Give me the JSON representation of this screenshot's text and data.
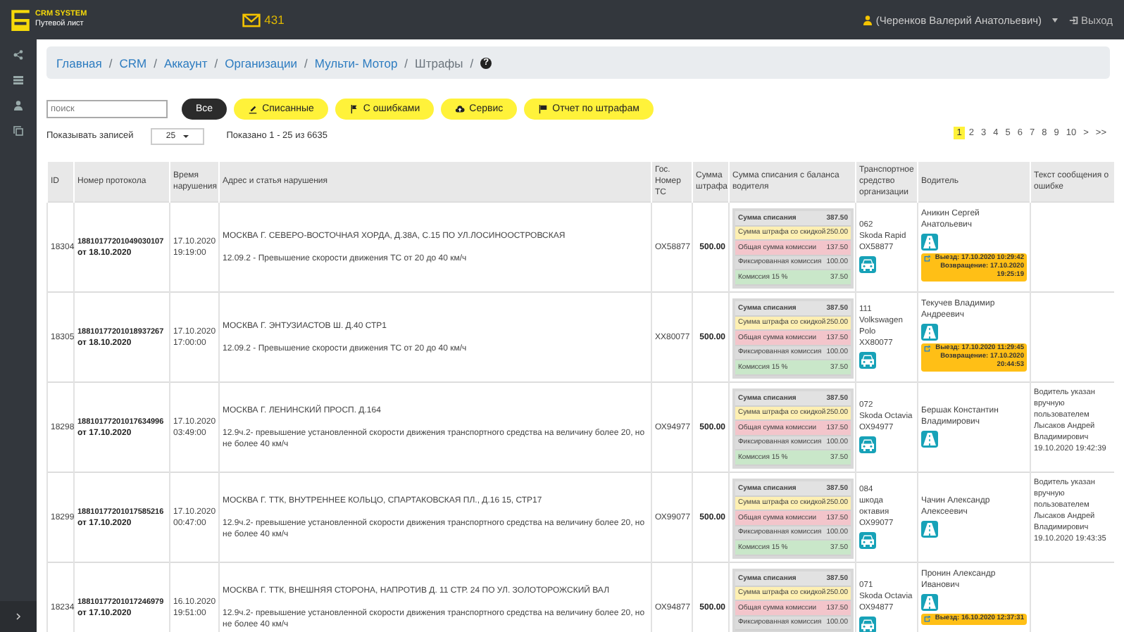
{
  "header": {
    "logo_title": "CRM SYSTEM",
    "logo_subtitle": "Путевой лист",
    "mail_count": "431",
    "user": "(Черенков Валерий Анатольевич)",
    "logout": "Выход"
  },
  "breadcrumb": [
    {
      "label": "Главная",
      "current": false,
      "separator": "/"
    },
    {
      "label": "CRM",
      "current": false,
      "separator": "/"
    },
    {
      "label": "Аккаунт",
      "current": false,
      "separator": "/"
    },
    {
      "label": "Организации",
      "current": false,
      "separator": "/"
    },
    {
      "label": "Мульти- Мотор",
      "current": false,
      "separator": "/"
    },
    {
      "label": "Штрафы",
      "current": true,
      "separator": "/"
    }
  ],
  "help": "?",
  "search": {
    "placeholder": "поиск"
  },
  "filters": [
    {
      "label": "Все",
      "selected": true
    },
    {
      "label": "Списанные",
      "selected": false
    },
    {
      "label": "С ошибками",
      "selected": false
    },
    {
      "label": "Сервис",
      "selected": false
    },
    {
      "label": "Отчет по штрафам",
      "selected": false
    }
  ],
  "page_size": {
    "label": "Показывать записей",
    "value": "25"
  },
  "summary": "Показано 1 - 25 из 6635",
  "pagination": {
    "pages": [
      {
        "label": "1",
        "selected": true
      },
      {
        "label": "2",
        "selected": false
      },
      {
        "label": "3",
        "selected": false
      },
      {
        "label": "4",
        "selected": false
      },
      {
        "label": "5",
        "selected": false
      },
      {
        "label": "6",
        "selected": false
      },
      {
        "label": "7",
        "selected": false
      },
      {
        "label": "8",
        "selected": false
      },
      {
        "label": "9",
        "selected": false
      },
      {
        "label": "10",
        "selected": false
      }
    ],
    "next": ">",
    "last": ">>"
  },
  "table": {
    "columns": [
      "ID",
      "Номер протокола",
      "Время нарушения",
      "Адрес и статья нарушения",
      "Гос. Номер ТС",
      "Сумма штрафа",
      "Сумма списания с баланса водителя",
      "Транспортное средство организации",
      "Водитель",
      "Текст сообщения о ошибке"
    ],
    "rows": [
      {
        "id": "18304",
        "protocol": "18810177201049030107",
        "protocol_date": "от 18.10.2020",
        "time": "17.10.2020 19:19:00",
        "address": "МОСКВА Г. СЕВЕРО-ВОСТОЧНАЯ ХОРДА, Д.38А, С.15 ПО УЛ.ЛОСИНООСТРОВСКАЯ",
        "article": "12.09.2 - Превышение скорости движения ТС от 20 до 40 км/ч",
        "plate": "ОХ58877",
        "fine": "500.00",
        "balance": [
          {
            "kind": "total",
            "label": "Сумма списания",
            "value": "387.50"
          },
          {
            "kind": "discount",
            "label": "Сумма штрафа со скидкой",
            "value": "250.00"
          },
          {
            "kind": "commission",
            "label": "Общая сумма комиссии",
            "value": "137.50"
          },
          {
            "kind": "fixed",
            "label": "Фиксированная комиссия",
            "value": "100.00"
          },
          {
            "kind": "percent",
            "label": "Комиссия 15 %",
            "value": "37.50"
          }
        ],
        "vehicle": [
          "062",
          "Skoda Rapid",
          "ОХ58877"
        ],
        "driver": "Аникин Сергей Анатольевич",
        "trip": [
          "Выезд: 17.10.2020 10:29:42",
          "Возвращение: 17.10.2020 19:25:19"
        ]
      },
      {
        "id": "18305",
        "protocol": "18810177201018937267",
        "protocol_date": "от 18.10.2020",
        "time": "17.10.2020 17:00:00",
        "address": "МОСКВА Г. ЭНТУЗИАСТОВ Ш. Д.40 СТР1",
        "article": "12.09.2 - Превышение скорости движения ТС от 20 до 40 км/ч",
        "plate": "ХХ80077",
        "fine": "500.00",
        "balance": [
          {
            "kind": "total",
            "label": "Сумма списания",
            "value": "387.50"
          },
          {
            "kind": "discount",
            "label": "Сумма штрафа со скидкой",
            "value": "250.00"
          },
          {
            "kind": "commission",
            "label": "Общая сумма комиссии",
            "value": "137.50"
          },
          {
            "kind": "fixed",
            "label": "Фиксированная комиссия",
            "value": "100.00"
          },
          {
            "kind": "percent",
            "label": "Комиссия 15 %",
            "value": "37.50"
          }
        ],
        "vehicle": [
          "111",
          "Volkswagen Polo",
          "ХХ80077"
        ],
        "driver": "Текучев Владимир Андреевич",
        "trip": [
          "Выезд: 17.10.2020 11:29:45",
          "Возвращение: 17.10.2020 20:44:53"
        ]
      },
      {
        "id": "18298",
        "protocol": "18810177201017634996",
        "protocol_date": "от 17.10.2020",
        "time": "17.10.2020 03:49:00",
        "address": "МОСКВА Г. ЛЕНИНСКИЙ ПРОСП. Д.164",
        "article": "12.9ч.2- превышение установленной скорости движения транспортного средства на величину более 20, но не более 40 км/ч",
        "plate": "ОХ94977",
        "fine": "500.00",
        "balance": [
          {
            "kind": "total",
            "label": "Сумма списания",
            "value": "387.50"
          },
          {
            "kind": "discount",
            "label": "Сумма штрафа со скидкой",
            "value": "250.00"
          },
          {
            "kind": "commission",
            "label": "Общая сумма комиссии",
            "value": "137.50"
          },
          {
            "kind": "fixed",
            "label": "Фиксированная комиссия",
            "value": "100.00"
          },
          {
            "kind": "percent",
            "label": "Комиссия 15 %",
            "value": "37.50"
          }
        ],
        "vehicle": [
          "072",
          "Skoda Octavia",
          "ОХ94977"
        ],
        "driver": "Бершак Константин Владимирович",
        "message": "Водитель указан вручную пользователем Лысаков Андрей Владимирович 19.10.2020 19:42:39"
      },
      {
        "id": "18299",
        "protocol": "18810177201017585216",
        "protocol_date": "от 17.10.2020",
        "time": "17.10.2020 00:47:00",
        "address": "МОСКВА Г. ТТК, ВНУТРЕННЕЕ КОЛЬЦО, СПАРТАКОВСКАЯ ПЛ., Д.16 15, СТР17",
        "article": "12.9ч.2- превышение установленной скорости движения транспортного средства на величину более 20, но не более 40 км/ч",
        "plate": "ОХ99077",
        "fine": "500.00",
        "balance": [
          {
            "kind": "total",
            "label": "Сумма списания",
            "value": "387.50"
          },
          {
            "kind": "discount",
            "label": "Сумма штрафа со скидкой",
            "value": "250.00"
          },
          {
            "kind": "commission",
            "label": "Общая сумма комиссии",
            "value": "137.50"
          },
          {
            "kind": "fixed",
            "label": "Фиксированная комиссия",
            "value": "100.00"
          },
          {
            "kind": "percent",
            "label": "Комиссия 15 %",
            "value": "37.50"
          }
        ],
        "vehicle": [
          "084",
          "шкода октавия",
          "ОХ99077"
        ],
        "driver": "Чачин Александр Алексеевич",
        "message": "Водитель указан вручную пользователем Лысаков Андрей Владимирович 19.10.2020 19:43:35"
      },
      {
        "id": "18234",
        "protocol": "18810177201017246979",
        "protocol_date": "от 17.10.2020",
        "time": "16.10.2020 19:51:00",
        "address": "МОСКВА Г. ТТК, ВНЕШНЯЯ СТОРОНА, НАПРОТИВ Д. 11 СТР. 24 ПО УЛ. ЗОЛОТОРОЖСКИЙ ВАЛ",
        "article": "12.9ч.2- превышение установленной скорости движения транспортного средства на величину более 20, но не более 40 км/ч",
        "plate": "ОХ94877",
        "fine": "500.00",
        "balance": [
          {
            "kind": "total",
            "label": "Сумма списания",
            "value": "387.50"
          },
          {
            "kind": "discount",
            "label": "Сумма штрафа со скидкой",
            "value": "250.00"
          },
          {
            "kind": "commission",
            "label": "Общая сумма комиссии",
            "value": "137.50"
          },
          {
            "kind": "fixed",
            "label": "Фиксированная комиссия",
            "value": "100.00"
          }
        ],
        "vehicle": [
          "071",
          "Skoda Octavia",
          "ОХ94877"
        ],
        "driver": "Пронин Александр Иванович",
        "trip": [
          "Выезд: 16.10.2020 12:37:31"
        ]
      }
    ]
  }
}
